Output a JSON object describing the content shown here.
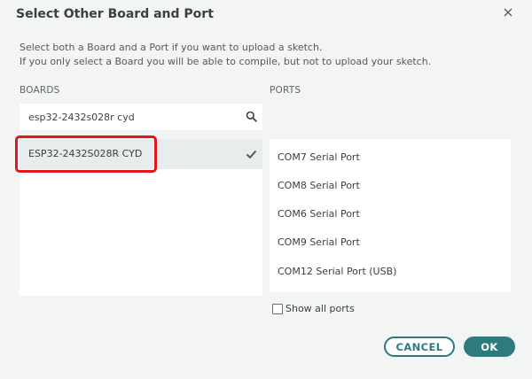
{
  "dialog": {
    "title": "Select Other Board and Port",
    "description_line1": "Select both a Board and a Port if you want to upload a sketch.",
    "description_line2": "If you only select a Board you will be able to compile, but not to upload your sketch."
  },
  "boards": {
    "label": "BOARDS",
    "search_value": "esp32-2432s028r cyd",
    "items": [
      {
        "name": "ESP32-2432S028R CYD",
        "selected": true
      }
    ]
  },
  "ports": {
    "label": "PORTS",
    "items": [
      {
        "name": "COM7 Serial Port"
      },
      {
        "name": "COM8 Serial Port"
      },
      {
        "name": "COM6 Serial Port"
      },
      {
        "name": "COM9 Serial Port"
      },
      {
        "name": "COM12 Serial Port (USB)"
      }
    ],
    "show_all_label": "Show all ports",
    "show_all_checked": false
  },
  "buttons": {
    "cancel": "CANCEL",
    "ok": "OK"
  },
  "colors": {
    "accent": "#2d7b7c",
    "highlight": "#e3161c",
    "selected_row": "#e7ecec"
  },
  "icons": {
    "close": "close-icon",
    "search": "search-icon",
    "check": "checkmark-icon"
  }
}
